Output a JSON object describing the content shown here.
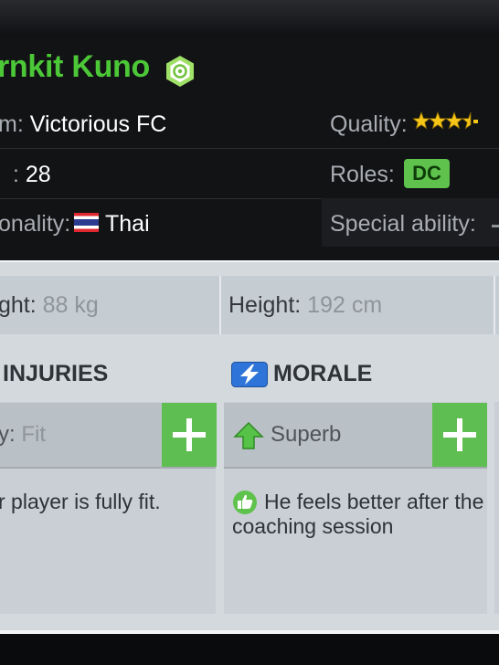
{
  "player": {
    "name": "rnkit Kuno",
    "team_label": "m:",
    "team_value": "Victorious FC",
    "age_label": ":",
    "age_value": "28",
    "nationality_label": "onality:",
    "nationality_value": "Thai",
    "quality_label": "Quality:",
    "quality_stars": 3.5,
    "roles_label": "Roles:",
    "role": "DC",
    "special_ability_label": "Special ability:"
  },
  "stats": {
    "weight_label": "ght:",
    "weight_value": "88 kg",
    "height_label": "Height:",
    "height_value": "192 cm"
  },
  "injuries": {
    "title": "INJURIES",
    "status_label": "y:",
    "status_value": "Fit",
    "description": "r player is fully fit."
  },
  "morale": {
    "title": "MORALE",
    "status_value": "Superb",
    "description_line1": "He feels better after the",
    "description_line2": "coaching session"
  },
  "icons": {
    "verified": "verified-badge-icon",
    "flag": "thailand-flag-icon",
    "lightning": "lightning-icon",
    "arrow_up": "arrow-up-icon",
    "plus": "plus-icon",
    "thumbs_up": "thumbs-up-icon"
  },
  "colors": {
    "accent_green": "#4cc738",
    "role_badge": "#5ec24c",
    "star_gold": "#f5c518",
    "morale_blue": "#2f74d8"
  }
}
